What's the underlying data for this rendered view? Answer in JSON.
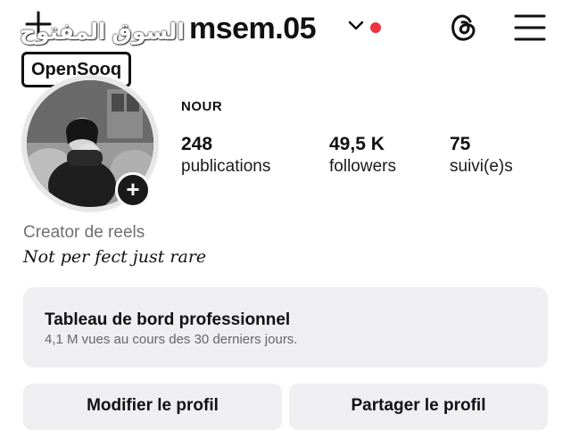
{
  "header": {
    "username": "msem.05"
  },
  "watermark": {
    "arabic": "السوق المفتوح",
    "brand": "OpenSooq"
  },
  "profile": {
    "display_name": "NOUR",
    "stats": [
      {
        "value": "248",
        "label": "publications"
      },
      {
        "value": "49,5 K",
        "label": "followers"
      },
      {
        "value": "75",
        "label": "suivi(e)s"
      }
    ],
    "category": "Creator de reels",
    "bio": "Not per fect just rare"
  },
  "dashboard": {
    "title": "Tableau de bord professionnel",
    "subtitle": "4,1 M vues au cours des 30 derniers jours."
  },
  "actions": {
    "edit_label": "Modifier le profil",
    "share_label": "Partager le profil"
  },
  "icons": {
    "create": "plus-icon",
    "account_switch": "chevron-down-icon",
    "notification": "red-dot",
    "threads": "threads-icon",
    "menu": "hamburger-menu-icon",
    "add_story": "plus-icon"
  },
  "colors": {
    "notification_dot": "#ef3340",
    "panel_bg": "#efeff1",
    "muted_text": "#707070"
  }
}
